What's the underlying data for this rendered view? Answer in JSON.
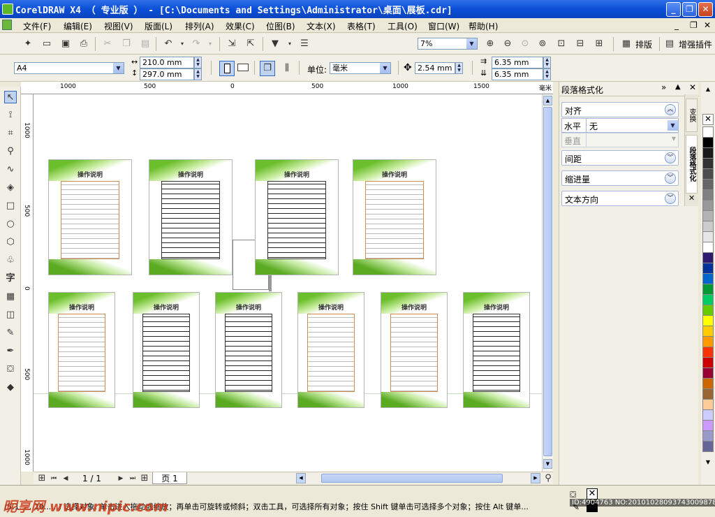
{
  "title": "CorelDRAW X4 （ 专业版 ） - [C:\\Documents and Settings\\Administrator\\桌面\\展板.cdr]",
  "window_buttons": {
    "minimize": "_",
    "restore": "❐",
    "close": "✕"
  },
  "menu": [
    "文件(F)",
    "编辑(E)",
    "视图(V)",
    "版面(L)",
    "排列(A)",
    "效果(C)",
    "位图(B)",
    "文本(X)",
    "表格(T)",
    "工具(O)",
    "窗口(W)",
    "帮助(H)"
  ],
  "doc_buttons": {
    "minimize": "_",
    "restore": "❐",
    "close": "✕"
  },
  "toolbar": {
    "zoom_value": "7%",
    "layout_label": "排版",
    "enhance_plugin_label": "增强插件"
  },
  "property_bar": {
    "page_size": "A4",
    "width": "210.0 mm",
    "height": "297.0 mm",
    "units_label": "单位:",
    "units_value": "毫米",
    "nudge": "2.54 mm",
    "dup_x": "6.35 mm",
    "dup_y": "6.35 mm"
  },
  "ruler": {
    "h_labels": [
      "1000",
      "500",
      "0",
      "500",
      "1000",
      "1500",
      "毫米"
    ],
    "v_labels": [
      "1000",
      "500",
      "0",
      "500",
      "1000"
    ]
  },
  "boards": {
    "title": "操作说明",
    "count": 10
  },
  "page_nav": {
    "counter": "1 / 1",
    "tab": "页 1"
  },
  "docker": {
    "title": "段落格式化",
    "sections": [
      "对齐",
      "间距",
      "缩进量",
      "文本方向"
    ],
    "horizontal_label": "水平",
    "horizontal_value": "无",
    "vertical_label": "垂直",
    "vertical_tabs": [
      "变换",
      "段落格式化"
    ]
  },
  "palette_colors": [
    "#ffffff",
    "#000000",
    "#1a1a1a",
    "#333333",
    "#4d4d4d",
    "#666666",
    "#808080",
    "#999999",
    "#b3b3b3",
    "#cccccc",
    "#e6e6e6",
    "#ffffff",
    "#2e1a6e",
    "#003399",
    "#0066cc",
    "#009933",
    "#00cc66",
    "#66cc00",
    "#ffff00",
    "#ffcc00",
    "#ff9900",
    "#ff3300",
    "#cc0000",
    "#990033",
    "#cc6600",
    "#996633",
    "#ffcc99",
    "#ccccff",
    "#cc99ff",
    "#9999cc",
    "#666699"
  ],
  "status": {
    "hint": "(5.1...., 20......) 选择对象. 单击进入拖动或缩放；再单击可旋转或倾斜；双击工具，可选择所有对象；按住 Shift 键单击可选择多个对象；按住 Alt 键单...",
    "watermark": "昵享网 www.nipic.com",
    "id_text": "ID:4904763 NO:20101028093743009878"
  }
}
